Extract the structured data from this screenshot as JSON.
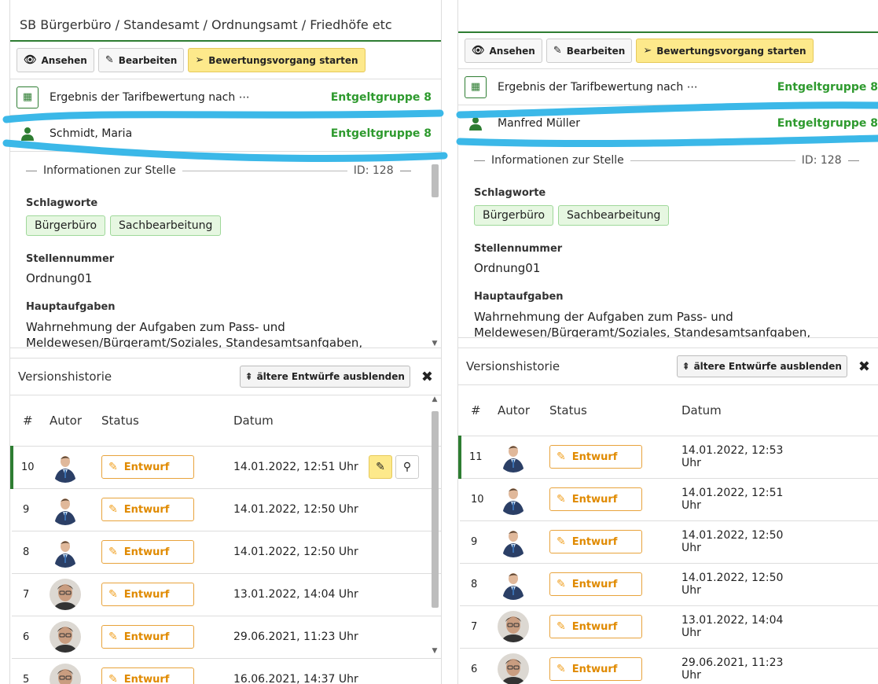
{
  "colors": {
    "accent_green": "#2e7d32",
    "grade_green": "#2e9a2e",
    "draft_orange": "#e08a00",
    "highlight_yellow": "#fde98b",
    "marker_blue": "#3bb8e8"
  },
  "left": {
    "title": "SB Bürgerbüro / Standesamt / Ordnungsamt / Friedhöfe etc",
    "toolbar": {
      "view": "Ansehen",
      "edit": "Bearbeiten",
      "start": "Bewertungsvorgang starten"
    },
    "result": {
      "label": "Ergebnis der Tarifbewertung nach ⋯",
      "grade": "Entgeltgruppe 8"
    },
    "person": {
      "name": "Schmidt, Maria",
      "grade": "Entgeltgruppe 8"
    },
    "info": {
      "legend": "Informationen zur Stelle",
      "id": "ID: 128",
      "tags_label": "Schlagworte",
      "tags": [
        "Bürgerbüro",
        "Sachbearbeitung"
      ],
      "number_label": "Stellennummer",
      "number": "Ordnung01",
      "tasks_label": "Hauptaufgaben",
      "tasks": "Wahrnehmung der Aufgaben zum Pass- und Meldewesen/Bürgeramt/Soziales, Standesamtsanfgaben,"
    },
    "history": {
      "title": "Versionshistorie",
      "hide_button": "ältere Entwürfe ausblenden",
      "columns": [
        "#",
        "Autor",
        "Status",
        "Datum"
      ],
      "rows": [
        {
          "num": "10",
          "status": "Entwurf",
          "date": "14.01.2022, 12:51 Uhr",
          "avatar": "avatar-a"
        },
        {
          "num": "9",
          "status": "Entwurf",
          "date": "14.01.2022, 12:50 Uhr",
          "avatar": "avatar-a"
        },
        {
          "num": "8",
          "status": "Entwurf",
          "date": "14.01.2022, 12:50 Uhr",
          "avatar": "avatar-a"
        },
        {
          "num": "7",
          "status": "Entwurf",
          "date": "13.01.2022, 14:04 Uhr",
          "avatar": "avatar-b"
        },
        {
          "num": "6",
          "status": "Entwurf",
          "date": "29.06.2021, 11:23 Uhr",
          "avatar": "avatar-b"
        },
        {
          "num": "5",
          "status": "Entwurf",
          "date": "16.06.2021, 14:37 Uhr",
          "avatar": "avatar-b"
        }
      ]
    }
  },
  "right": {
    "toolbar": {
      "view": "Ansehen",
      "edit": "Bearbeiten",
      "start": "Bewertungsvorgang starten"
    },
    "result": {
      "label": "Ergebnis der Tarifbewertung nach ⋯",
      "grade": "Entgeltgruppe 8"
    },
    "person": {
      "name": "Manfred Müller",
      "grade": "Entgeltgruppe 8"
    },
    "info": {
      "legend": "Informationen zur Stelle",
      "id": "ID: 128",
      "tags_label": "Schlagworte",
      "tags": [
        "Bürgerbüro",
        "Sachbearbeitung"
      ],
      "number_label": "Stellennummer",
      "number": "Ordnung01",
      "tasks_label": "Hauptaufgaben",
      "tasks": "Wahrnehmung der Aufgaben zum Pass- und Meldewesen/Bürgeramt/Soziales, Standesamtsanfgaben,"
    },
    "history": {
      "title": "Versionshistorie",
      "hide_button": "ältere Entwürfe ausblenden",
      "columns": [
        "#",
        "Autor",
        "Status",
        "Datum"
      ],
      "rows": [
        {
          "num": "11",
          "status": "Entwurf",
          "date": "14.01.2022, 12:53 Uhr",
          "avatar": "avatar-a"
        },
        {
          "num": "10",
          "status": "Entwurf",
          "date": "14.01.2022, 12:51 Uhr",
          "avatar": "avatar-a"
        },
        {
          "num": "9",
          "status": "Entwurf",
          "date": "14.01.2022, 12:50 Uhr",
          "avatar": "avatar-a"
        },
        {
          "num": "8",
          "status": "Entwurf",
          "date": "14.01.2022, 12:50 Uhr",
          "avatar": "avatar-a"
        },
        {
          "num": "7",
          "status": "Entwurf",
          "date": "13.01.2022, 14:04 Uhr",
          "avatar": "avatar-b"
        },
        {
          "num": "6",
          "status": "Entwurf",
          "date": "29.06.2021, 11:23 Uhr",
          "avatar": "avatar-b"
        }
      ]
    }
  }
}
